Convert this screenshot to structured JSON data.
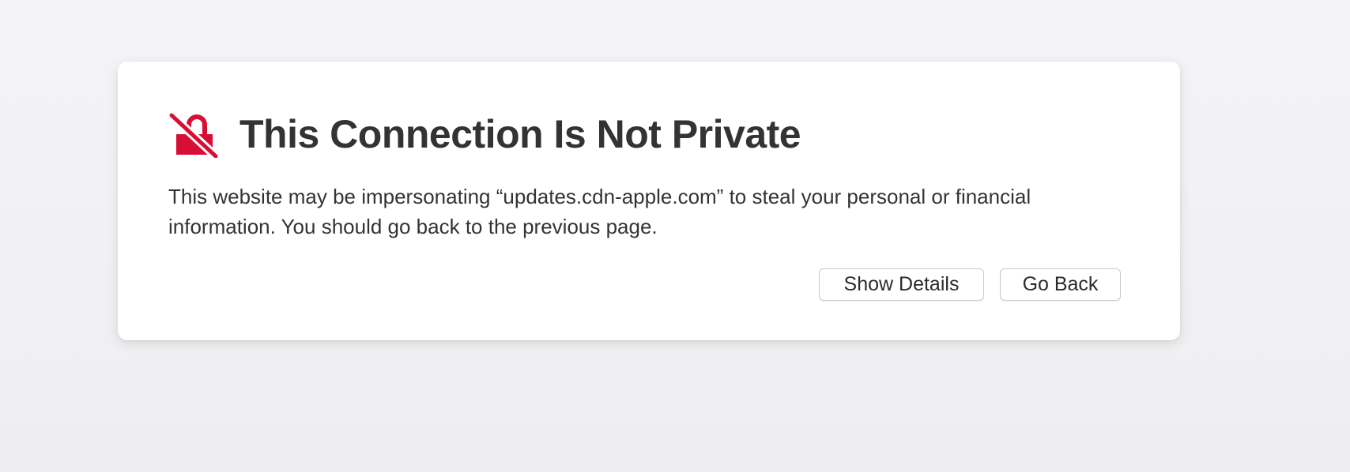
{
  "dialog": {
    "icon": "broken-lock-icon",
    "accent_color": "#d70f35",
    "title": "This Connection Is Not Private",
    "message": "This website may be impersonating “updates.cdn-apple.com” to steal your personal or financial information. You should go back to the previous page.",
    "buttons": {
      "show_details": "Show Details",
      "go_back": "Go Back"
    }
  }
}
